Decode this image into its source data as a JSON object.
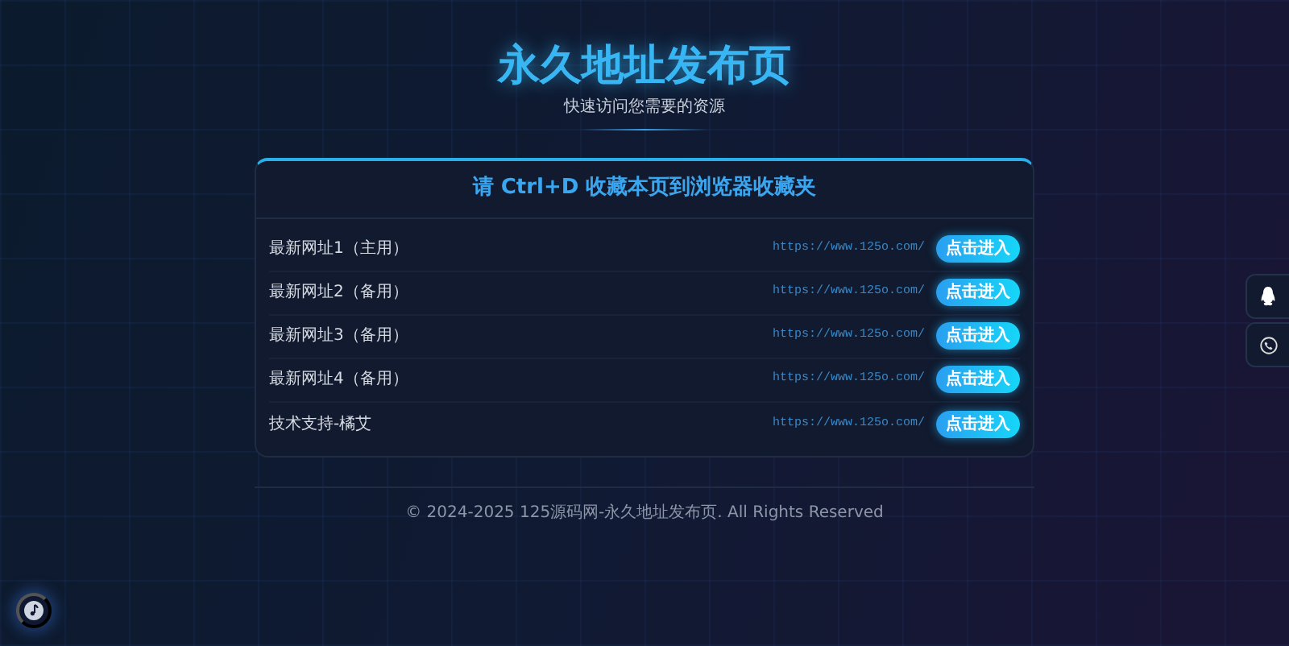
{
  "header": {
    "title": "永久地址发布页",
    "subtitle": "快速访问您需要的资源"
  },
  "card": {
    "title": "请 Ctrl+D 收藏本页到浏览器收藏夹",
    "rows": [
      {
        "label": "最新网址1（主用）",
        "url": "https://www.125o.com/",
        "button": "点击进入"
      },
      {
        "label": "最新网址2（备用）",
        "url": "https://www.125o.com/",
        "button": "点击进入"
      },
      {
        "label": "最新网址3（备用）",
        "url": "https://www.125o.com/",
        "button": "点击进入"
      },
      {
        "label": "最新网址4（备用）",
        "url": "https://www.125o.com/",
        "button": "点击进入"
      },
      {
        "label": "技术支持-橘艾",
        "url": "https://www.125o.com/",
        "button": "点击进入"
      }
    ]
  },
  "footer": "© 2024-2025 125源码网-永久地址发布页. All Rights Reserved"
}
